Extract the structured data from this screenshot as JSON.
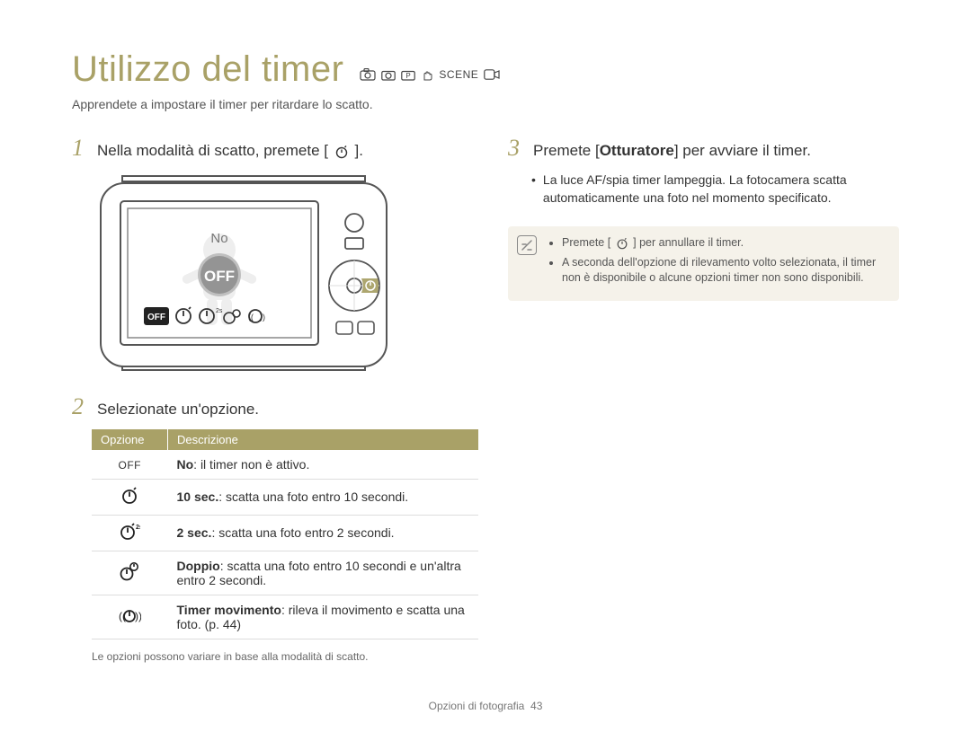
{
  "title": "Utilizzo del timer",
  "mode_icons": [
    "smart-icon",
    "camera-icon",
    "programP-icon",
    "hand-icon",
    "scene-icon",
    "video-icon"
  ],
  "subtitle": "Apprendete a impostare il timer per ritardare lo scatto.",
  "left": {
    "step1_num": "1",
    "step1_txt_pre": "Nella modalità di scatto, premete [",
    "step1_txt_post": "].",
    "camera_label": "No",
    "step2_num": "2",
    "step2_txt": "Selezionate un'opzione.",
    "table_headers": [
      "Opzione",
      "Descrizione"
    ],
    "rows": [
      {
        "icon": "off-text-icon",
        "bold": "No",
        "rest": ": il timer non è attivo."
      },
      {
        "icon": "timer10-icon",
        "bold": "10 sec.",
        "rest": ": scatta una foto entro 10 secondi."
      },
      {
        "icon": "timer2-icon",
        "bold": "2 sec.",
        "rest": ": scatta una foto entro 2 secondi."
      },
      {
        "icon": "timer-double-icon",
        "bold": "Doppio",
        "rest": ": scatta una foto entro 10 secondi e un'altra entro 2 secondi."
      },
      {
        "icon": "timer-motion-icon",
        "bold": "Timer movimento",
        "rest": ": rileva il movimento e scatta una foto. (p. 44)"
      }
    ],
    "footnote": "Le opzioni possono variare in base alla modalità di scatto."
  },
  "right": {
    "step3_num": "3",
    "step3_part1": "Premete [",
    "step3_bold": "Otturatore",
    "step3_part2": "] per avviare il timer.",
    "bullet": "La luce AF/spia timer lampeggia. La fotocamera scatta automaticamente una foto nel momento specificato.",
    "notes": [
      {
        "pre": "Premete [",
        "post": "] per annullare il timer.",
        "icon": true
      },
      {
        "text": "A seconda dell'opzione di rilevamento volto selezionata, il timer non è disponibile o alcune opzioni timer non sono disponibili."
      }
    ]
  },
  "footer": {
    "section": "Opzioni di fotografia",
    "page": "43"
  }
}
